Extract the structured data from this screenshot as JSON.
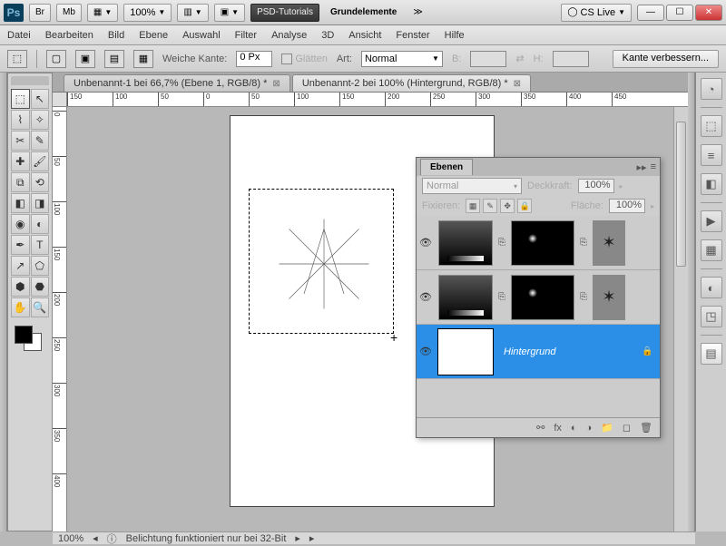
{
  "titlebar": {
    "app": "Ps",
    "bridge": "Br",
    "mb": "Mb",
    "zoom": "100%",
    "psd_tutorials": "PSD-Tutorials",
    "grundelemente": "Grundelemente",
    "cslive": "CS Live"
  },
  "menu": [
    "Datei",
    "Bearbeiten",
    "Bild",
    "Ebene",
    "Auswahl",
    "Filter",
    "Analyse",
    "3D",
    "Ansicht",
    "Fenster",
    "Hilfe"
  ],
  "options": {
    "weiche_kante": "Weiche Kante:",
    "weiche_kante_val": "0 Px",
    "glaetten": "Glätten",
    "art": "Art:",
    "art_val": "Normal",
    "b": "B:",
    "h": "H:",
    "kante": "Kante verbessern..."
  },
  "tabs": [
    {
      "label": "Unbenannt-1 bei 66,7% (Ebene 1, RGB/8) *",
      "active": false
    },
    {
      "label": "Unbenannt-2 bei 100% (Hintergrund, RGB/8) *",
      "active": true
    }
  ],
  "ruler_h": [
    150,
    100,
    50,
    0,
    50,
    100,
    150,
    200,
    250,
    300,
    350,
    400,
    450
  ],
  "ruler_v": [
    0,
    50,
    100,
    150,
    200,
    250,
    300,
    350,
    400
  ],
  "layers_panel": {
    "title": "Ebenen",
    "blend": "Normal",
    "deckkraft_label": "Deckkraft:",
    "deckkraft_val": "100%",
    "fixieren": "Fixieren:",
    "flaeche_label": "Fläche:",
    "flaeche_val": "100%",
    "hintergrund": "Hintergrund"
  },
  "status": {
    "zoom": "100%",
    "msg": "Belichtung funktioniert nur bei 32-Bit"
  },
  "tool_names": [
    [
      "marquee",
      "move"
    ],
    [
      "lasso",
      "wand"
    ],
    [
      "crop",
      "eyedropper"
    ],
    [
      "heal",
      "brush"
    ],
    [
      "stamp",
      "history"
    ],
    [
      "eraser",
      "gradient"
    ],
    [
      "blur",
      "dodge"
    ],
    [
      "pen",
      "type"
    ],
    [
      "path",
      "shape"
    ],
    [
      "3d",
      "3dcam"
    ],
    [
      "hand",
      "zoom"
    ]
  ],
  "dock_icons": [
    "color",
    "swatches",
    "adjust",
    "masks",
    "sep",
    "play",
    "styles",
    "sep",
    "circle",
    "cube",
    "sep",
    "layers"
  ]
}
